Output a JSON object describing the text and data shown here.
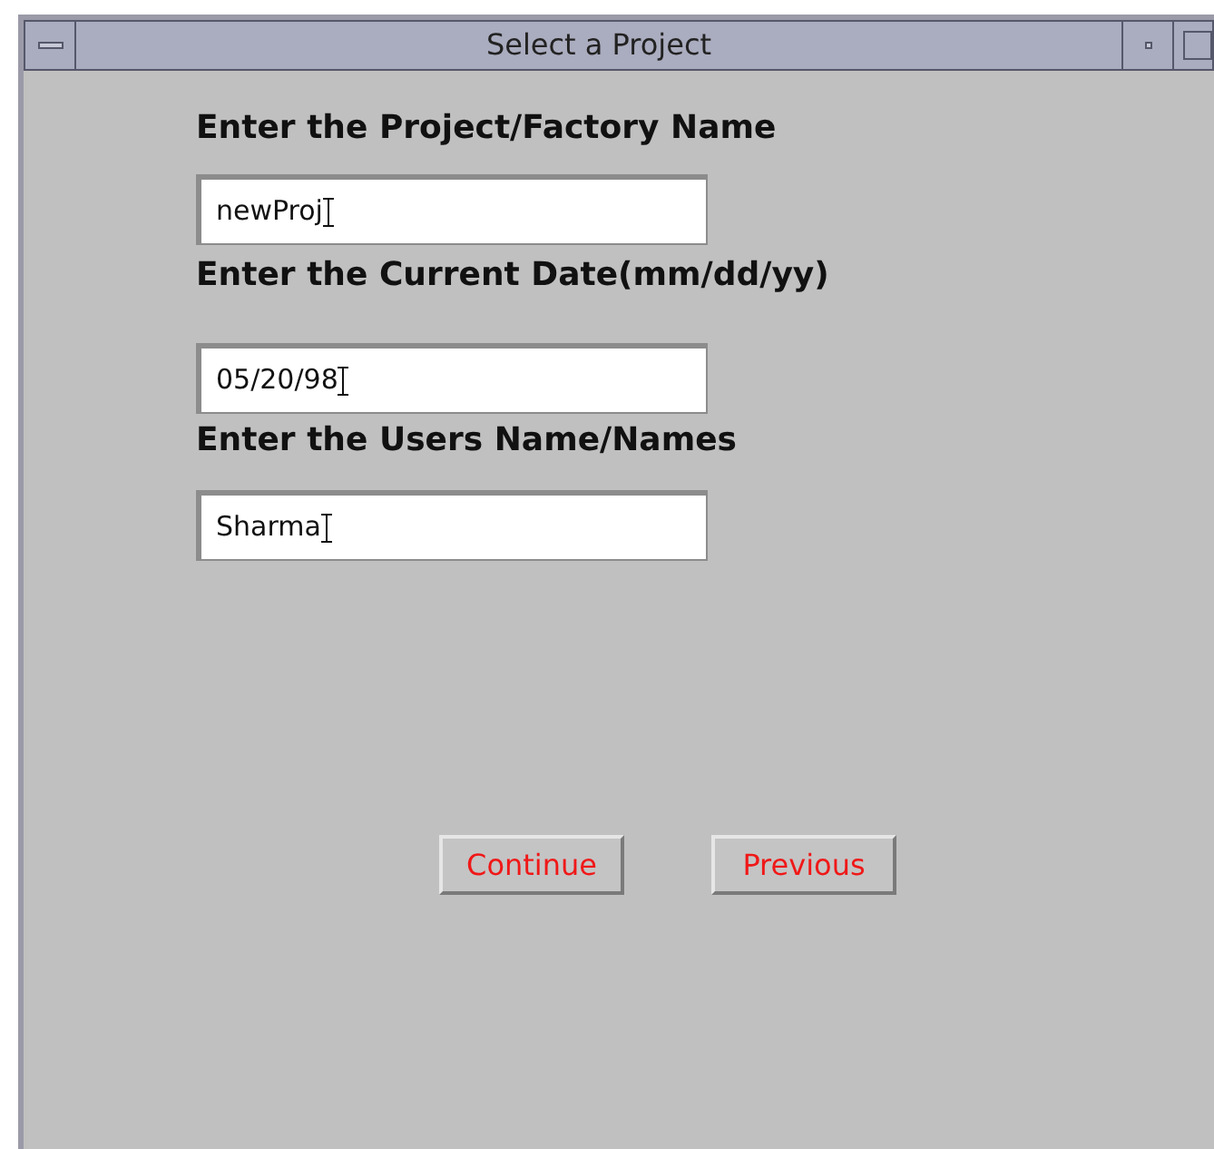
{
  "window": {
    "title": "Select a Project"
  },
  "fields": [
    {
      "label": "Enter the Project/Factory Name",
      "value": "newProj"
    },
    {
      "label": "Enter the Current Date(mm/dd/yy)",
      "value": "05/20/98"
    },
    {
      "label": "Enter the Users Name/Names",
      "value": "Sharma"
    }
  ],
  "buttons": [
    "Continue",
    "Previous"
  ]
}
